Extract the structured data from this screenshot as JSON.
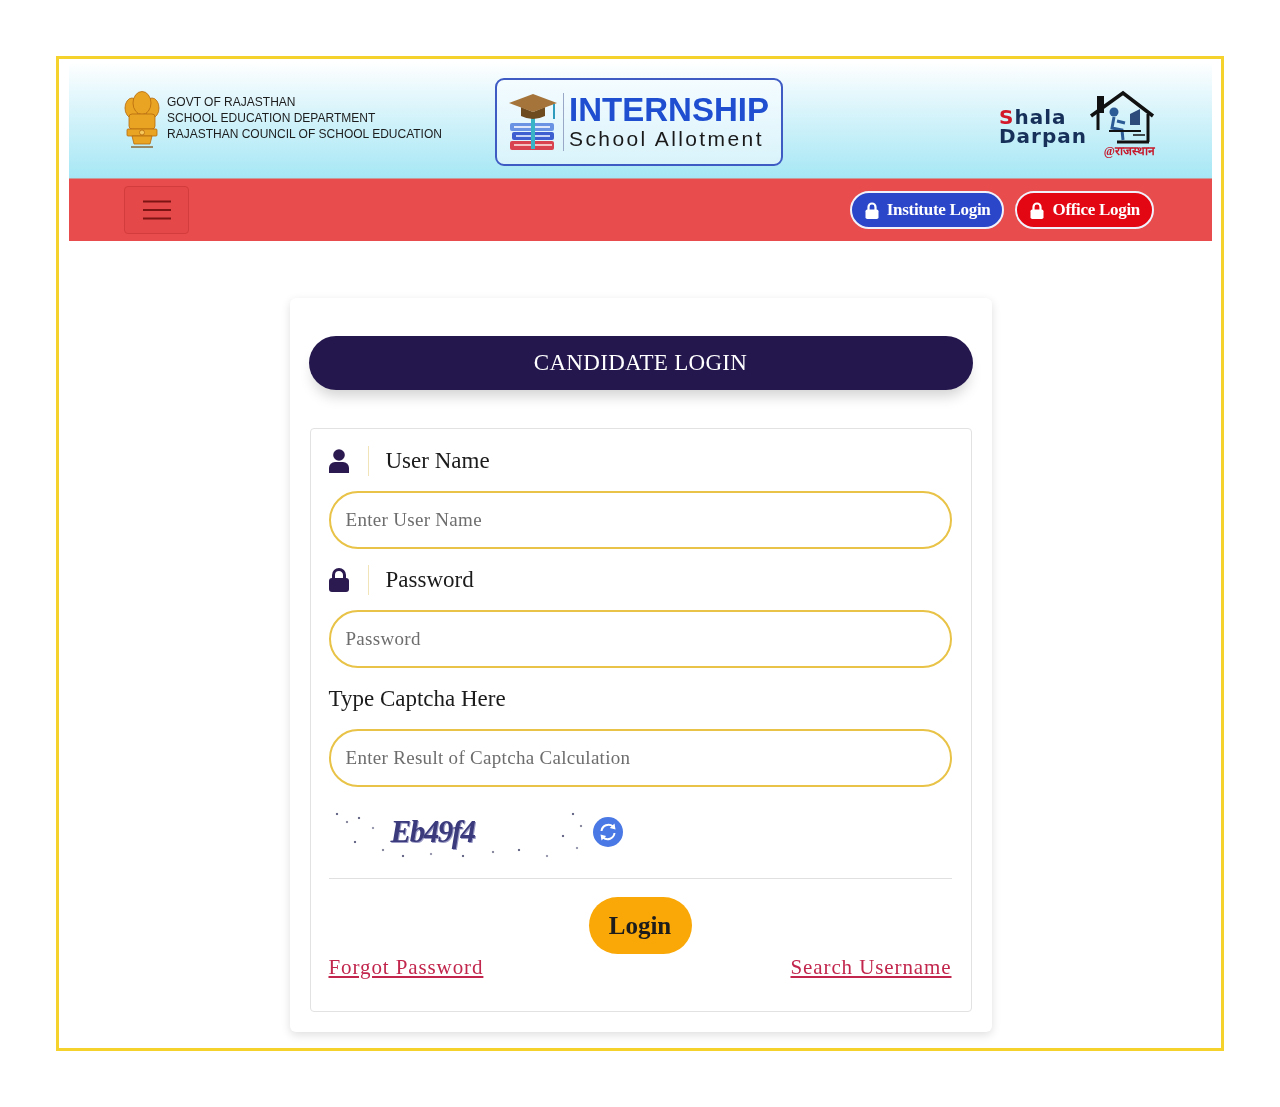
{
  "header": {
    "department_lines": [
      "GOVT OF RAJASTHAN",
      "SCHOOL EDUCATION DEPARTMENT",
      "RAJASTHAN COUNCIL OF SCHOOL EDUCATION"
    ],
    "app_logo": {
      "title": "INTERNSHIP",
      "subtitle": "School Allotment"
    },
    "portal_logo": {
      "name_lines": [
        "Shala",
        "Darpan"
      ],
      "tagline": "@राजस्थान"
    }
  },
  "navbar": {
    "buttons": [
      {
        "label": "Institute Login",
        "color": "#2b46c9"
      },
      {
        "label": "Office Login",
        "color": "#e30613"
      }
    ]
  },
  "login": {
    "title": "CANDIDATE LOGIN",
    "fields": [
      {
        "kind": "user",
        "label": "User Name",
        "placeholder": "Enter User Name"
      },
      {
        "kind": "password",
        "label": "Password",
        "placeholder": "Password"
      },
      {
        "kind": "captcha",
        "label": "Type Captcha Here",
        "placeholder": "Enter Result of Captcha Calculation"
      }
    ],
    "captcha": {
      "text": "Eb49f4"
    },
    "submit": "Login",
    "links": [
      "Forgot Password",
      "Search Username"
    ]
  }
}
